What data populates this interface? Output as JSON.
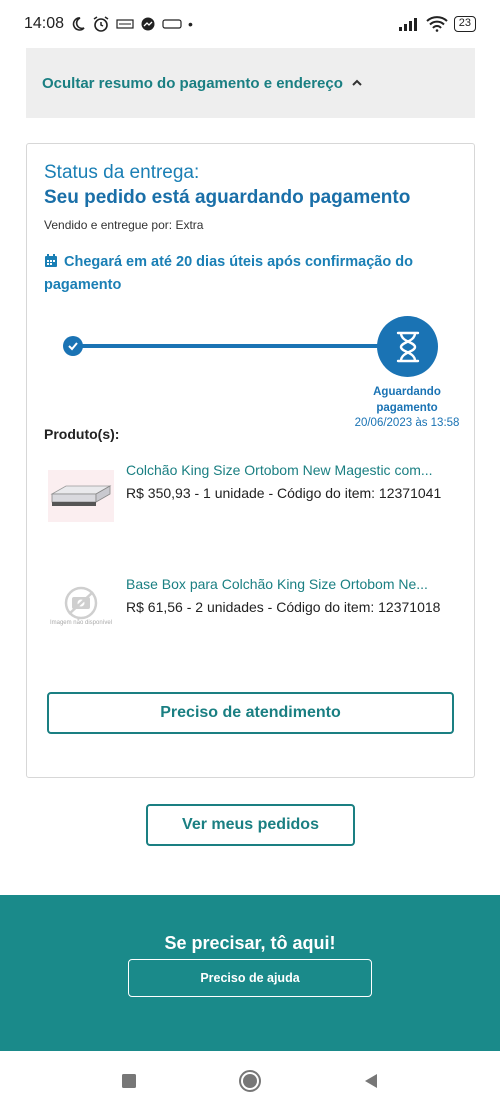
{
  "status_bar": {
    "time": "14:08",
    "battery": "23"
  },
  "summary": {
    "toggle_label": "Ocultar resumo do pagamento e endereço"
  },
  "delivery": {
    "status_label": "Status da entrega:",
    "status_title": "Seu pedido está aguardando pagamento",
    "seller": "Vendido e entregue por: Extra",
    "eta": "Chegará em até 20 dias úteis após confirmação do pagamento",
    "current_step_label": "Aguardando pagamento",
    "current_step_date": "20/06/2023 às 13:58"
  },
  "products": {
    "title": "Produto(s):",
    "items": [
      {
        "name": "Colchão King Size Ortobom New Magestic com...",
        "info": "R$ 350,93 - 1 unidade - Código do item: 12371041",
        "image_alt": ""
      },
      {
        "name": "Base Box para Colchão King Size Ortobom Ne...",
        "info": "R$ 61,56 - 2 unidades - Código do item: 12371018",
        "image_alt": "Imagem não disponível"
      }
    ]
  },
  "buttons": {
    "attendance": "Preciso de atendimento",
    "my_orders": "Ver meus pedidos"
  },
  "footer": {
    "title": "Se precisar, tô aqui!",
    "help_button": "Preciso de ajuda"
  },
  "colors": {
    "teal": "#1a8a8a",
    "blue": "#1a73b4"
  }
}
